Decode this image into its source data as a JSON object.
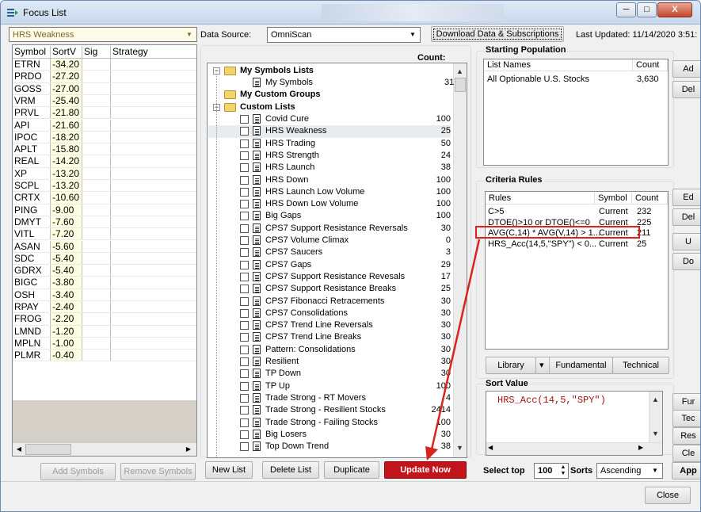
{
  "window": {
    "title": "Focus List",
    "minimize": "─",
    "maximize": "□",
    "close": "X",
    "close_button": "Close"
  },
  "left": {
    "list_selector": "HRS Weakness",
    "columns": [
      "Symbol",
      "SortV",
      "Sig",
      "Strategy"
    ],
    "rows": [
      {
        "symbol": "ETRN",
        "sortv": "-34.20"
      },
      {
        "symbol": "PRDO",
        "sortv": "-27.20"
      },
      {
        "symbol": "GOSS",
        "sortv": "-27.00"
      },
      {
        "symbol": "VRM",
        "sortv": "-25.40"
      },
      {
        "symbol": "PRVL",
        "sortv": "-21.80"
      },
      {
        "symbol": "API",
        "sortv": "-21.60"
      },
      {
        "symbol": "IPOC",
        "sortv": "-18.20"
      },
      {
        "symbol": "APLT",
        "sortv": "-15.80"
      },
      {
        "symbol": "REAL",
        "sortv": "-14.20"
      },
      {
        "symbol": "XP",
        "sortv": "-13.20"
      },
      {
        "symbol": "SCPL",
        "sortv": "-13.20"
      },
      {
        "symbol": "CRTX",
        "sortv": "-10.60"
      },
      {
        "symbol": "PING",
        "sortv": "-9.00"
      },
      {
        "symbol": "DMYT",
        "sortv": "-7.60"
      },
      {
        "symbol": "VITL",
        "sortv": "-7.20"
      },
      {
        "symbol": "ASAN",
        "sortv": "-5.60"
      },
      {
        "symbol": "SDC",
        "sortv": "-5.40"
      },
      {
        "symbol": "GDRX",
        "sortv": "-5.40"
      },
      {
        "symbol": "BIGC",
        "sortv": "-3.80"
      },
      {
        "symbol": "OSH",
        "sortv": "-3.40"
      },
      {
        "symbol": "RPAY",
        "sortv": "-2.40"
      },
      {
        "symbol": "FROG",
        "sortv": "-2.20"
      },
      {
        "symbol": "LMND",
        "sortv": "-1.20"
      },
      {
        "symbol": "MPLN",
        "sortv": "-1.00"
      },
      {
        "symbol": "PLMR",
        "sortv": "-0.40"
      }
    ],
    "add_symbols": "Add Symbols",
    "remove_symbols": "Remove Symbols"
  },
  "toolbar": {
    "data_source_label": "Data Source:",
    "data_source_value": "OmniScan",
    "download_button": "Download Data & Subscriptions",
    "last_updated": "Last Updated: 11/14/2020 3:51:"
  },
  "tree": {
    "count_header": "Count:",
    "groups": {
      "my_symbols_lists": "My Symbols Lists",
      "my_symbols": "My Symbols",
      "my_symbols_count": "31",
      "my_custom_groups": "My Custom Groups",
      "custom_lists": "Custom Lists"
    },
    "items": [
      {
        "name": "Covid Cure",
        "count": "100"
      },
      {
        "name": "HRS Weakness",
        "count": "25"
      },
      {
        "name": "HRS Trading",
        "count": "50"
      },
      {
        "name": "HRS Strength",
        "count": "24"
      },
      {
        "name": "HRS Launch",
        "count": "38"
      },
      {
        "name": "HRS Down",
        "count": "100"
      },
      {
        "name": "HRS Launch Low Volume",
        "count": "100"
      },
      {
        "name": "HRS Down Low Volume",
        "count": "100"
      },
      {
        "name": "Big Gaps",
        "count": "100"
      },
      {
        "name": "CPS7 Support Resistance Reversals",
        "count": "30"
      },
      {
        "name": "CPS7 Volume Climax",
        "count": "0"
      },
      {
        "name": "CPS7 Saucers",
        "count": "3"
      },
      {
        "name": "CPS7 Gaps",
        "count": "29"
      },
      {
        "name": "CPS7 Support Resistance Revesals",
        "count": "17"
      },
      {
        "name": "CPS7 Support Resistance Breaks",
        "count": "25"
      },
      {
        "name": "CPS7 Fibonacci Retracements",
        "count": "30"
      },
      {
        "name": "CPS7 Consolidations",
        "count": "30"
      },
      {
        "name": "CPS7 Trend Line Reversals",
        "count": "30"
      },
      {
        "name": "CPS7 Trend Line Breaks",
        "count": "30"
      },
      {
        "name": "Pattern: Consolidations",
        "count": "30"
      },
      {
        "name": "Resilient",
        "count": "30"
      },
      {
        "name": "TP Down",
        "count": "30"
      },
      {
        "name": "TP Up",
        "count": "100"
      },
      {
        "name": "Trade Strong - RT Movers",
        "count": "4"
      },
      {
        "name": "Trade Strong - Resilient Stocks",
        "count": "2414"
      },
      {
        "name": "Trade Strong - Failing Stocks",
        "count": "100"
      },
      {
        "name": "Big Losers",
        "count": "30"
      },
      {
        "name": "Top Down Trend",
        "count": "38"
      }
    ],
    "new_list": "New List",
    "delete_list": "Delete List",
    "duplicate": "Duplicate",
    "update_now": "Update Now"
  },
  "starting_population": {
    "title": "Starting Population",
    "col_list_names": "List Names",
    "col_count": "Count",
    "rows": [
      {
        "name": "All Optionable U.S. Stocks",
        "count": "3,630"
      }
    ],
    "add": "Ad",
    "delete": "Del"
  },
  "criteria": {
    "title": "Criteria Rules",
    "col_rules": "Rules",
    "col_symbol": "Symbol",
    "col_count": "Count",
    "rows": [
      {
        "rule": "C>5",
        "symbol": "Current",
        "count": "232"
      },
      {
        "rule": "DTOE()>10 or DTOE()<=0",
        "symbol": "Current",
        "count": "225"
      },
      {
        "rule": "AVG(C,14) * AVG(V,14) > 1...",
        "symbol": "Current",
        "count": "211"
      },
      {
        "rule": "HRS_Acc(14,5,\"SPY\") < 0...",
        "symbol": "Current",
        "count": "25"
      }
    ],
    "side_buttons": [
      "Ed",
      "Del",
      "U",
      "Do"
    ],
    "library": "Library",
    "fundamental": "Fundamental",
    "technical": "Technical"
  },
  "sort_value": {
    "title": "Sort Value",
    "formula": "HRS_Acc(14,5,\"SPY\")",
    "side_buttons": [
      "Fur",
      "Tec",
      "Res",
      "Cle"
    ],
    "select_top_label": "Select top",
    "select_top_value": "100",
    "sort_label": "Sorts",
    "sort_value": "Ascending",
    "apply": "App"
  },
  "colors": {
    "sortv_bg": "#ffffe1",
    "update_red": "#c2141b",
    "arrow_red": "#d9231d",
    "highlight_box": "#d9231d"
  }
}
